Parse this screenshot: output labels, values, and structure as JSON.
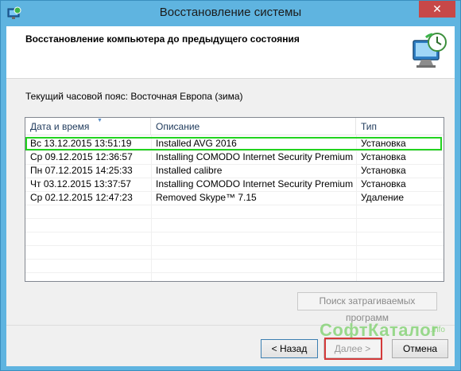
{
  "window": {
    "title": "Восстановление системы",
    "close_label": "✕"
  },
  "header": {
    "title": "Восстановление компьютера до предыдущего состояния"
  },
  "timezone_text": "Текущий часовой пояс: Восточная Европа (зима)",
  "table": {
    "columns": [
      "Дата и время",
      "Описание",
      "Тип"
    ],
    "rows": [
      {
        "date": "Вс 13.12.2015 13:51:19",
        "description": "Installed AVG 2016",
        "type": "Установка"
      },
      {
        "date": "Ср 09.12.2015 12:36:57",
        "description": "Installing COMODO Internet Security Premium",
        "type": "Установка"
      },
      {
        "date": "Пн 07.12.2015 14:25:33",
        "description": "Installed calibre",
        "type": "Установка"
      },
      {
        "date": "Чт 03.12.2015 13:37:57",
        "description": "Installing COMODO Internet Security Premium",
        "type": "Установка"
      },
      {
        "date": "Ср 02.12.2015 12:47:23",
        "description": "Removed Skype™ 7.15",
        "type": "Удаление"
      }
    ],
    "selected_row": 0,
    "highlight_color": "#22d31f"
  },
  "buttons": {
    "scan_affected": "Поиск затрагиваемых программ",
    "back": "< Назад",
    "next": "Далее >",
    "cancel": "Отмена"
  },
  "watermark": {
    "main": "СофтКаталог",
    "sub": ".info"
  },
  "colors": {
    "titlebar": "#5fb4e0",
    "close_button": "#c74848",
    "next_outline": "#d43a3a"
  }
}
